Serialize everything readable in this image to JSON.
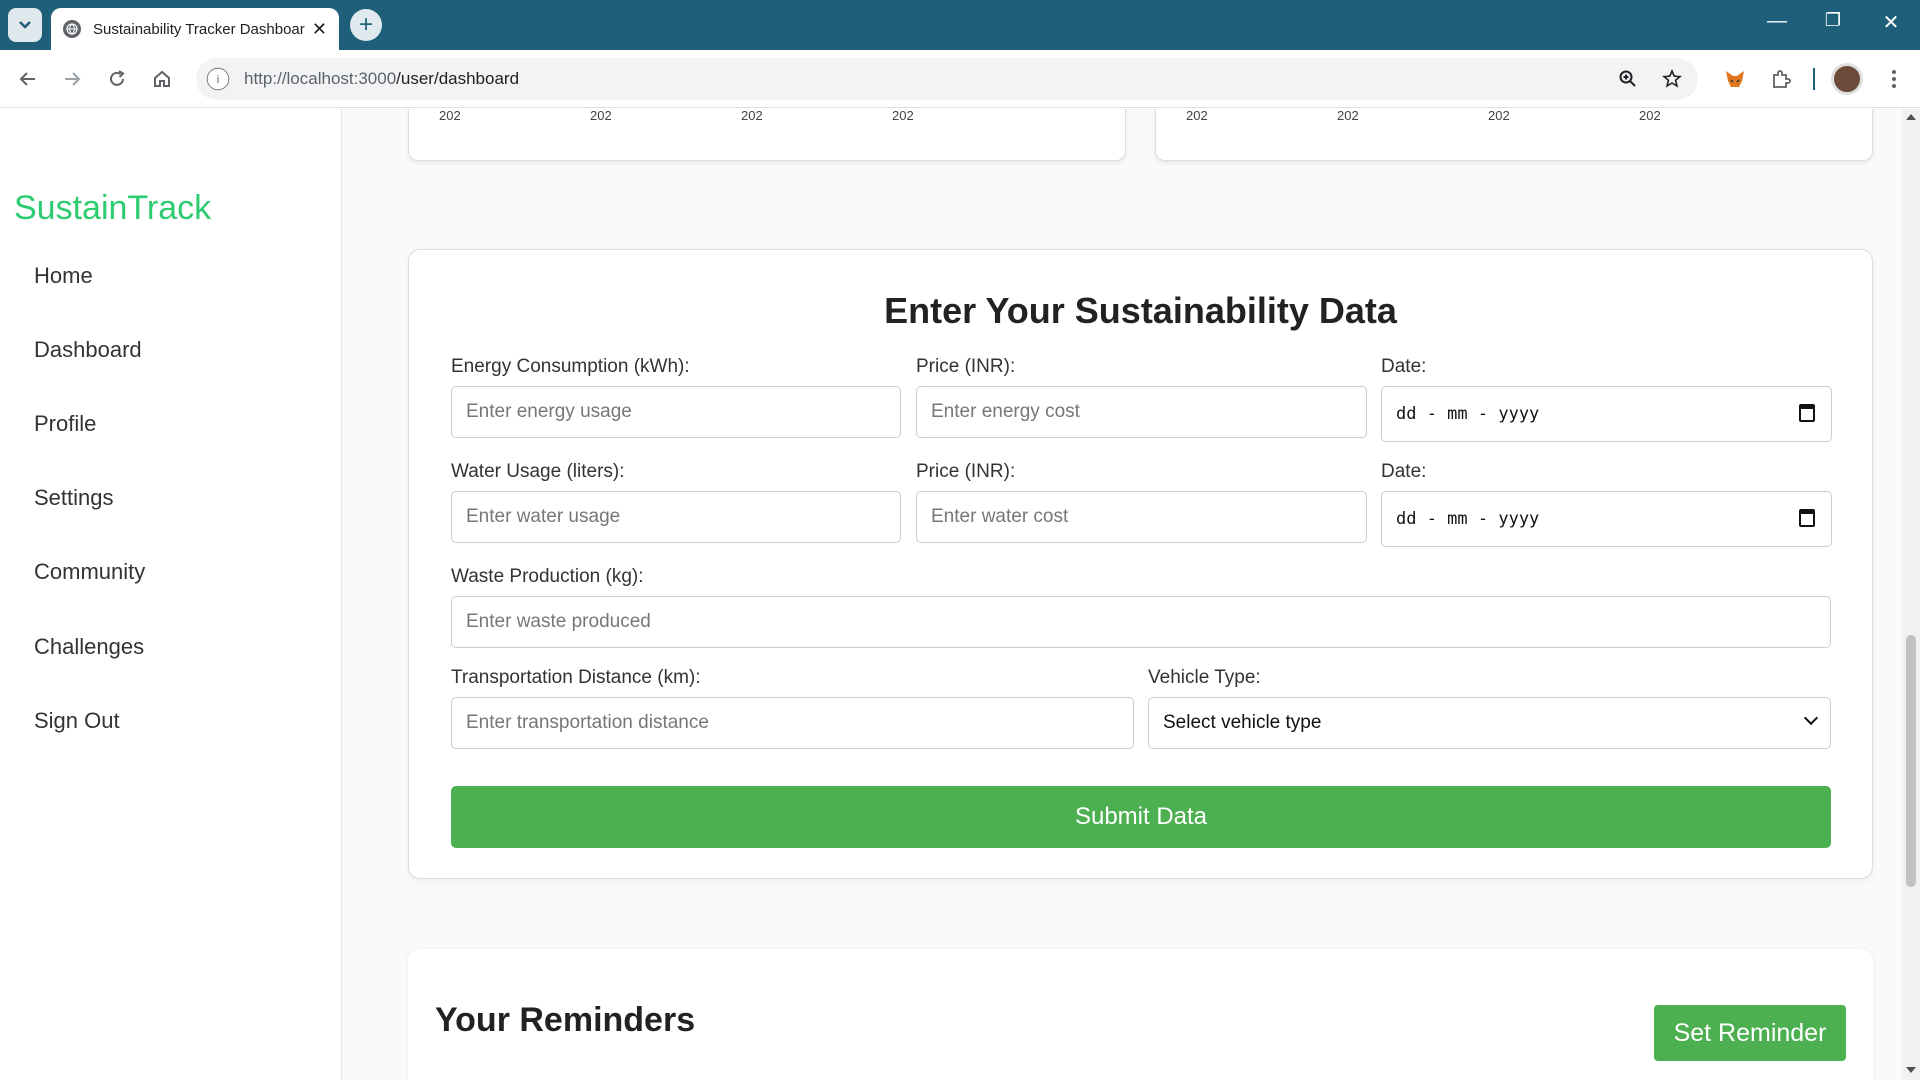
{
  "browser": {
    "tab_title": "Sustainability Tracker Dashboard",
    "tab_close": "✕",
    "new_tab": "+",
    "url_host": "http://localhost:3000",
    "url_path": "/user/dashboard",
    "win_minimize": "—",
    "win_restore": "❐",
    "win_close": "✕"
  },
  "sidebar": {
    "brand": "SustainTrack",
    "brand_color": "#2ecc71",
    "items": [
      {
        "label": "Home"
      },
      {
        "label": "Dashboard"
      },
      {
        "label": "Profile"
      },
      {
        "label": "Settings"
      },
      {
        "label": "Community"
      },
      {
        "label": "Challenges"
      },
      {
        "label": "Sign Out"
      }
    ]
  },
  "charts": {
    "left_ticks": [
      "202",
      "202",
      "202",
      "202"
    ],
    "right_ticks": [
      "202",
      "202",
      "202",
      "202"
    ]
  },
  "form": {
    "title": "Enter Your Sustainability Data",
    "energy_label": "Energy Consumption (kWh):",
    "energy_placeholder": "Enter energy usage",
    "energy_price_label": "Price (INR):",
    "energy_price_placeholder": "Enter energy cost",
    "energy_date_label": "Date:",
    "energy_date_value": "dd - mm - yyyy",
    "water_label": "Water Usage (liters):",
    "water_placeholder": "Enter water usage",
    "water_price_label": "Price (INR):",
    "water_price_placeholder": "Enter water cost",
    "water_date_label": "Date:",
    "water_date_value": "dd - mm - yyyy",
    "waste_label": "Waste Production (kg):",
    "waste_placeholder": "Enter waste produced",
    "transport_label": "Transportation Distance (km):",
    "transport_placeholder": "Enter transportation distance",
    "vehicle_label": "Vehicle Type:",
    "vehicle_selected": "Select vehicle type",
    "submit_label": "Submit Data",
    "accent": "#4caf50"
  },
  "reminders": {
    "title": "Your Reminders",
    "set_label": "Set Reminder"
  }
}
